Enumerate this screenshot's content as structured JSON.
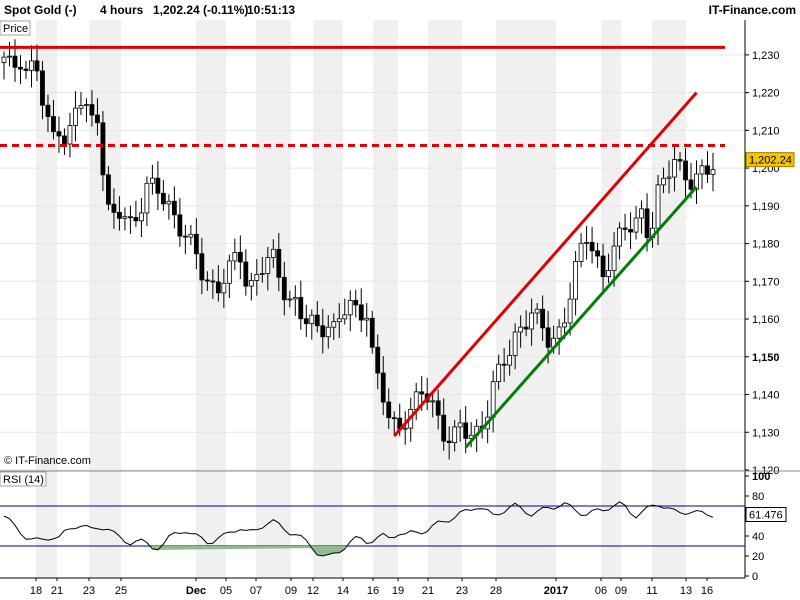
{
  "header": {
    "instrument": "Spot Gold (-)",
    "timeframe": "4 hours",
    "last_price_change": "1,202.24 (-0.11%)",
    "time": "10:51:13",
    "brand": "IT-Finance.com"
  },
  "price_panel": {
    "label": "Price",
    "watermark": "© IT-Finance.com",
    "last_price_tag": "1,202.24",
    "last_price_tag_color": "#f5c400"
  },
  "rsi_panel": {
    "label": "RSI (14)",
    "last_value_tag": "61.476"
  },
  "x_axis_labels": [
    "18",
    "21",
    "23",
    "25",
    "Dec",
    "05",
    "07",
    "09",
    "12",
    "14",
    "16",
    "19",
    "21",
    "23",
    "28",
    "2017",
    "06",
    "09",
    "11",
    "13",
    "16"
  ],
  "colors": {
    "candle_up": "#ffffff",
    "candle_down": "#000000",
    "resistance": "#e00000",
    "upper_channel": "#e00000",
    "lower_channel": "#008000",
    "rsi_line": "#000000",
    "rsi_bounds": "#00008b",
    "oversold_fill": "#8fbc8f",
    "grid_band": "#f0f0f0"
  },
  "chart_data": [
    {
      "type": "candlestick",
      "title": "",
      "ylabel": "Price",
      "ylim": [
        1120,
        1235
      ],
      "y_ticks": [
        1120,
        1130,
        1140,
        1150,
        1160,
        1170,
        1180,
        1190,
        1200,
        1210,
        1220,
        1230
      ],
      "y_tick_labels": [
        "1,120",
        "1,130",
        "1,140",
        "1,150",
        "1,160",
        "1,170",
        "1,180",
        "1,190",
        "1,200",
        "1,210",
        "1,220",
        "1,230"
      ],
      "close_path_approx": [
        1228,
        1226,
        1230,
        1225,
        1229,
        1215,
        1208,
        1212,
        1206,
        1215,
        1218,
        1212,
        1215,
        1190,
        1186,
        1188,
        1185,
        1188,
        1196,
        1194,
        1192,
        1190,
        1186,
        1183,
        1178,
        1172,
        1170,
        1168,
        1172,
        1174,
        1176,
        1168,
        1172,
        1175,
        1176,
        1170,
        1166,
        1165,
        1160,
        1158,
        1156,
        1160,
        1158,
        1162,
        1163,
        1160,
        1164,
        1148,
        1140,
        1132,
        1130,
        1135,
        1138,
        1140,
        1138,
        1134,
        1130,
        1129,
        1131,
        1128,
        1130,
        1134,
        1142,
        1146,
        1150,
        1156,
        1160,
        1162,
        1158,
        1154,
        1155,
        1160,
        1168,
        1176,
        1182,
        1178,
        1172,
        1176,
        1180,
        1185,
        1186,
        1189,
        1180,
        1192,
        1198,
        1204,
        1200,
        1195,
        1196,
        1200,
        1202.24
      ],
      "horizontal_levels": [
        {
          "price": 1232,
          "style": "solid",
          "color": "#e00000"
        },
        {
          "price": 1206,
          "style": "dashed",
          "color": "#e00000"
        }
      ],
      "trend_lines": [
        {
          "from": [
            71,
            1129
          ],
          "to": [
            126,
            1220
          ],
          "color": "#e00000"
        },
        {
          "from": [
            84,
            1126
          ],
          "to": [
            126,
            1195
          ],
          "color": "#008000"
        }
      ],
      "last_price": 1202.24
    },
    {
      "type": "line",
      "title": "",
      "ylabel": "RSI (14)",
      "ylim": [
        0,
        100
      ],
      "y_ticks": [
        0,
        20,
        40,
        60,
        80,
        100
      ],
      "y_tick_labels": [
        "0",
        "20",
        "40",
        "60",
        "80",
        "100"
      ],
      "bounds": [
        30,
        70
      ],
      "values_approx": [
        60,
        52,
        45,
        38,
        35,
        36,
        40,
        38,
        45,
        50,
        52,
        45,
        48,
        50,
        42,
        35,
        34,
        36,
        32,
        28,
        30,
        38,
        44,
        46,
        40,
        38,
        34,
        36,
        40,
        46,
        48,
        42,
        46,
        52,
        55,
        50,
        45,
        42,
        36,
        30,
        22,
        18,
        22,
        28,
        34,
        38,
        35,
        36,
        40,
        38,
        44,
        40,
        44,
        45,
        46,
        52,
        56,
        58,
        62,
        66,
        70,
        66,
        60,
        64,
        68,
        70,
        66,
        62,
        64,
        68,
        70,
        72,
        68,
        64,
        62,
        64,
        66,
        70,
        72,
        68,
        60,
        64,
        68,
        72,
        70,
        64,
        62,
        66,
        64,
        60,
        61.476
      ],
      "last_value": 61.476
    }
  ]
}
